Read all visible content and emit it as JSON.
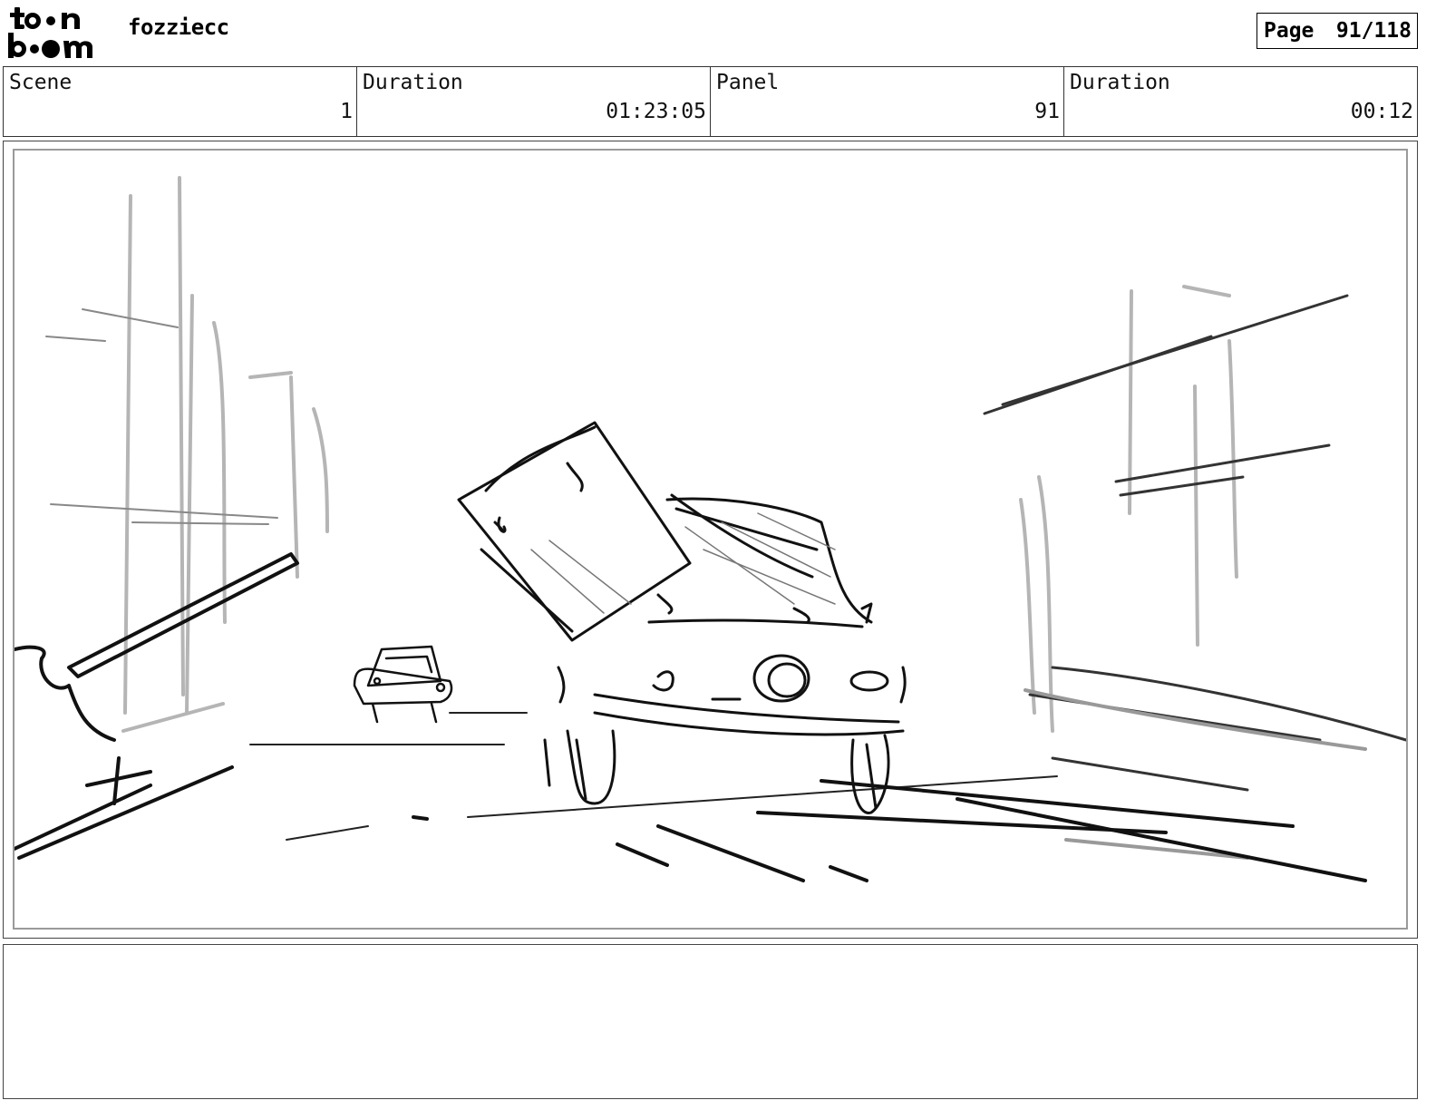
{
  "header": {
    "logo": "toon boom",
    "project_name": "fozziecc",
    "page_label": "Page",
    "page_number": "91/118"
  },
  "info": {
    "scene_label": "Scene",
    "scene_value": "1",
    "scene_duration_label": "Duration",
    "scene_duration_value": "01:23:05",
    "panel_label": "Panel",
    "panel_value": "91",
    "panel_duration_label": "Duration",
    "panel_duration_value": "00:12"
  },
  "panel": {
    "drawing": "rough storyboard sketch"
  },
  "notes": {
    "text": ""
  }
}
